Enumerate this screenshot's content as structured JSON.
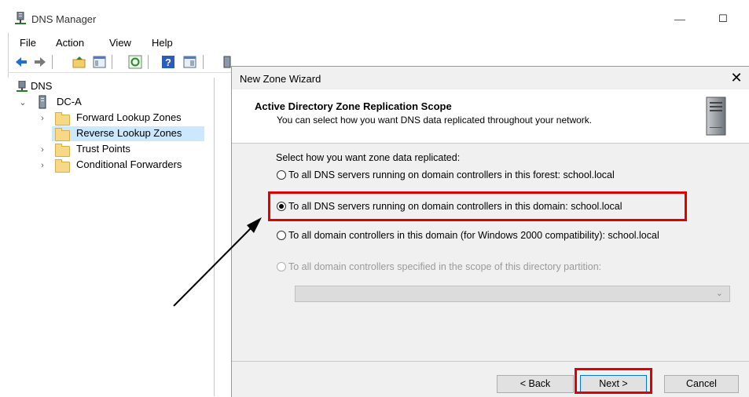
{
  "app": {
    "title": "DNS Manager"
  },
  "window_controls": {
    "minimize": "—",
    "maximize": "☐"
  },
  "menu": [
    "File",
    "Action",
    "View",
    "Help"
  ],
  "toolbar_icons": [
    "back-arrow-icon",
    "forward-arrow-icon",
    "folder-up-icon",
    "console-tree-icon",
    "refresh-icon",
    "help-icon",
    "properties-icon",
    "server-icon",
    "list-icon",
    "folder-icon"
  ],
  "tree": {
    "root": "DNS",
    "server": "DC-A",
    "children": [
      "Forward Lookup Zones",
      "Reverse Lookup Zones",
      "Trust Points",
      "Conditional Forwarders"
    ],
    "selected": "Reverse Lookup Zones"
  },
  "dialog": {
    "title": "New Zone Wizard",
    "close": "✕",
    "header_title": "Active Directory Zone Replication Scope",
    "header_subtitle": "You can select how you want DNS data replicated throughout your network.",
    "prompt": "Select how you want zone data replicated:",
    "options": [
      {
        "label": "To all DNS servers running on domain controllers in this forest: school.local",
        "selected": false,
        "enabled": true
      },
      {
        "label": "To all DNS servers running on domain controllers in this domain: school.local",
        "selected": true,
        "enabled": true
      },
      {
        "label": "To all domain controllers in this domain (for Windows 2000 compatibility): school.local",
        "selected": false,
        "enabled": true
      },
      {
        "label": "To all domain controllers specified in the scope of this directory partition:",
        "selected": false,
        "enabled": false
      }
    ],
    "partition_value": "",
    "buttons": {
      "back": "< Back",
      "next": "Next >",
      "cancel": "Cancel"
    }
  },
  "annotation_color": "#e00000"
}
